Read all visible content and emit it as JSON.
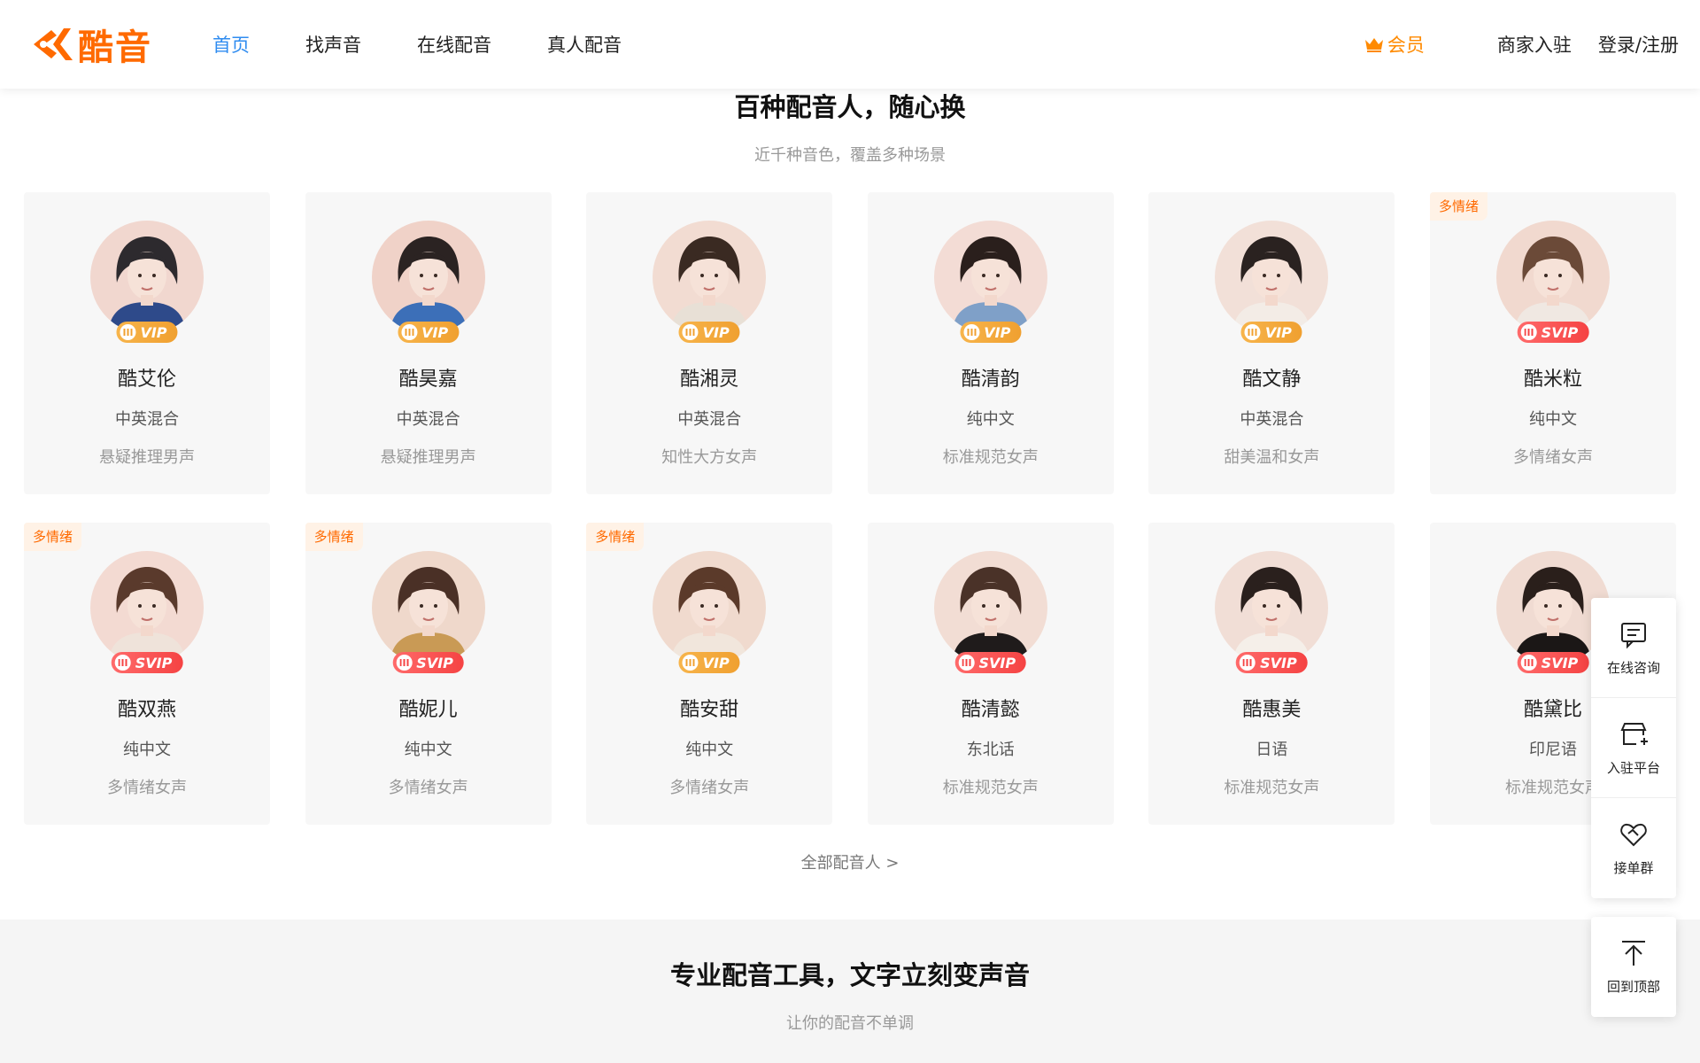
{
  "header": {
    "logo_text": "酷音",
    "nav": [
      "首页",
      "找声音",
      "在线配音",
      "真人配音"
    ],
    "member": "会员",
    "merchant": "商家入驻",
    "login": "登录/注册"
  },
  "section1": {
    "title": "百种配音人，随心换",
    "subtitle": "近千种音色，覆盖多种场景"
  },
  "voices": [
    {
      "name": "酷艾伦",
      "lang": "中英混合",
      "desc": "悬疑推理男声",
      "badge": "VIP",
      "tag": ""
    },
    {
      "name": "酷昊嘉",
      "lang": "中英混合",
      "desc": "悬疑推理男声",
      "badge": "VIP",
      "tag": ""
    },
    {
      "name": "酷湘灵",
      "lang": "中英混合",
      "desc": "知性大方女声",
      "badge": "VIP",
      "tag": ""
    },
    {
      "name": "酷清韵",
      "lang": "纯中文",
      "desc": "标准规范女声",
      "badge": "VIP",
      "tag": ""
    },
    {
      "name": "酷文静",
      "lang": "中英混合",
      "desc": "甜美温和女声",
      "badge": "VIP",
      "tag": ""
    },
    {
      "name": "酷米粒",
      "lang": "纯中文",
      "desc": "多情绪女声",
      "badge": "SVIP",
      "tag": "多情绪"
    },
    {
      "name": "酷双燕",
      "lang": "纯中文",
      "desc": "多情绪女声",
      "badge": "SVIP",
      "tag": "多情绪"
    },
    {
      "name": "酷妮儿",
      "lang": "纯中文",
      "desc": "多情绪女声",
      "badge": "SVIP",
      "tag": "多情绪"
    },
    {
      "name": "酷安甜",
      "lang": "纯中文",
      "desc": "多情绪女声",
      "badge": "VIP",
      "tag": "多情绪"
    },
    {
      "name": "酷清懿",
      "lang": "东北话",
      "desc": "标准规范女声",
      "badge": "SVIP",
      "tag": ""
    },
    {
      "name": "酷惠美",
      "lang": "日语",
      "desc": "标准规范女声",
      "badge": "SVIP",
      "tag": ""
    },
    {
      "name": "酷黛比",
      "lang": "印尼语",
      "desc": "标准规范女声",
      "badge": "SVIP",
      "tag": ""
    }
  ],
  "more_link": "全部配音人 >",
  "section2": {
    "title": "专业配音工具，文字立刻变声音",
    "subtitle": "让你的配音不单调"
  },
  "sidebar": {
    "consult": "在线咨询",
    "join": "入驻平台",
    "group": "接单群",
    "top": "回到顶部"
  },
  "colors": {
    "accent": "#ff6a00",
    "nav_active": "#2f8cf0",
    "vip": "#f0a030",
    "svip": "#f54343"
  }
}
